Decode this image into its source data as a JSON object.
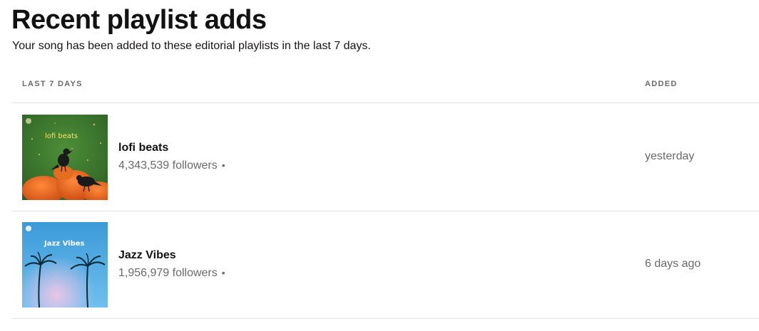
{
  "header": {
    "title": "Recent playlist adds",
    "subtitle": "Your song has been added to these editorial playlists in the last 7 days."
  },
  "table": {
    "col_left": "LAST 7 DAYS",
    "col_right": "ADDED",
    "rows": [
      {
        "name": "lofi beats",
        "followers": "4,343,539 followers",
        "added": "yesterday",
        "cover_text": "lofi beats",
        "cover_icon": "spotify-logo"
      },
      {
        "name": "Jazz Vibes",
        "followers": "1,956,979 followers",
        "added": "6 days ago",
        "cover_text": "Jazz Vibes",
        "cover_icon": "spotify-logo"
      }
    ],
    "separator": "•"
  },
  "colors": {
    "title": "#121212",
    "muted": "#6a6a6a",
    "divider": "#e3e3e3",
    "lofi_bg": "#3c7a2f",
    "lofi_pumpkin": "#e8631a",
    "jazz_sky": "#4aa9e0"
  }
}
